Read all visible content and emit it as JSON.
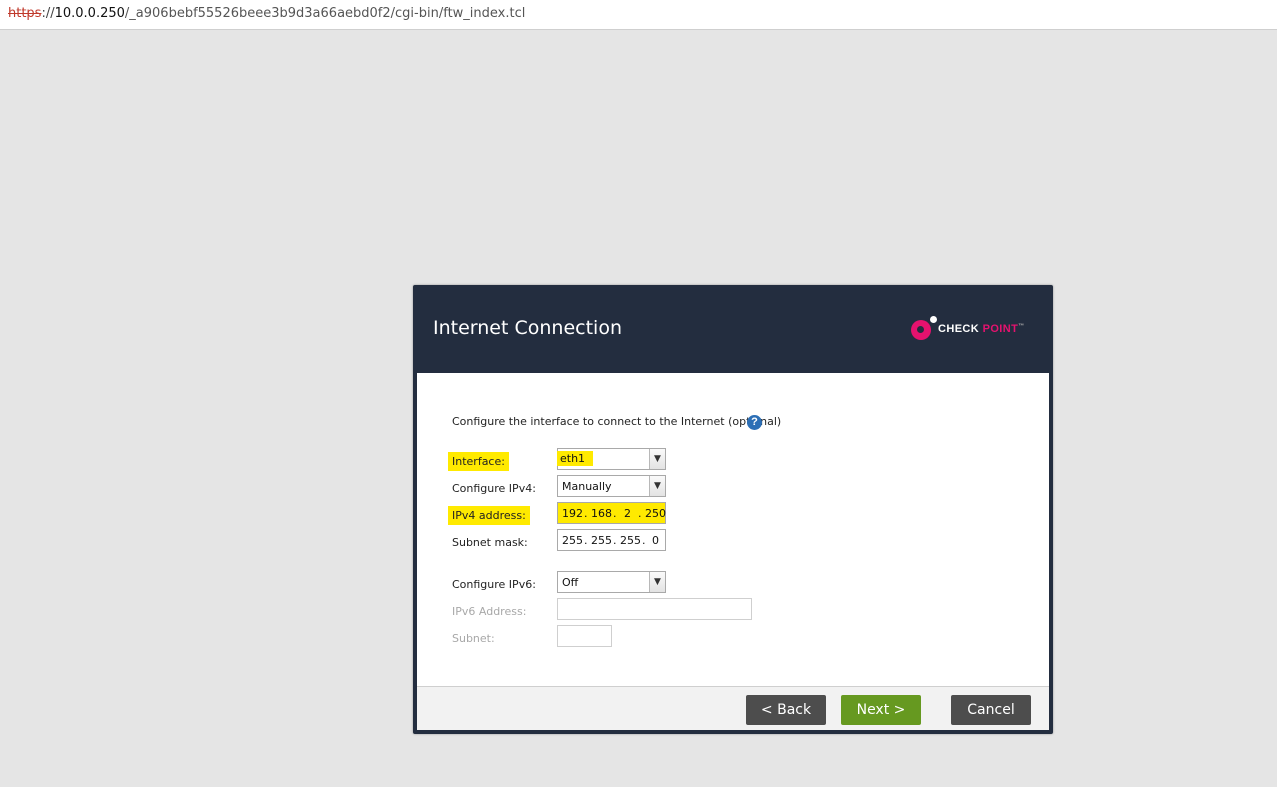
{
  "browser": {
    "url_scheme": "https",
    "url_sep": "://",
    "url_host": "10.0.0.250",
    "url_path": "/_a906bebf55526beee3b9d3a66aebd0f2/cgi-bin/ftw_index.tcl"
  },
  "dialog": {
    "title": "Internet Connection",
    "logo_word1": "CHECK",
    "logo_word2": "POINT",
    "logo_tm": "™",
    "intro": "Configure the interface to connect to the Internet (optional)",
    "help_glyph": "?",
    "fields": {
      "interface": {
        "label": "Interface:",
        "value": "eth1"
      },
      "configure_ipv4": {
        "label": "Configure IPv4:",
        "value": "Manually"
      },
      "ipv4_address": {
        "label": "IPv4 address:",
        "octets": [
          "192",
          "168",
          "2",
          "250"
        ]
      },
      "subnet_mask": {
        "label": "Subnet mask:",
        "octets": [
          "255",
          "255",
          "255",
          "0"
        ]
      },
      "configure_ipv6": {
        "label": "Configure IPv6:",
        "value": "Off"
      },
      "ipv6_address": {
        "label": "IPv6 Address:",
        "value": ""
      },
      "subnet": {
        "label": "Subnet:",
        "value": ""
      }
    },
    "ip_dot": ".",
    "buttons": {
      "back": "< Back",
      "next": "Next >",
      "cancel": "Cancel"
    }
  },
  "colors": {
    "header_bg": "#232d3f",
    "highlight": "#ffea00",
    "next_button": "#669920",
    "dark_button": "#4d4d4d",
    "brand": "#e5126e"
  },
  "icons": {
    "help": "help-icon",
    "dropdown": "chevron-down-icon",
    "logo": "checkpoint-logo-icon"
  }
}
